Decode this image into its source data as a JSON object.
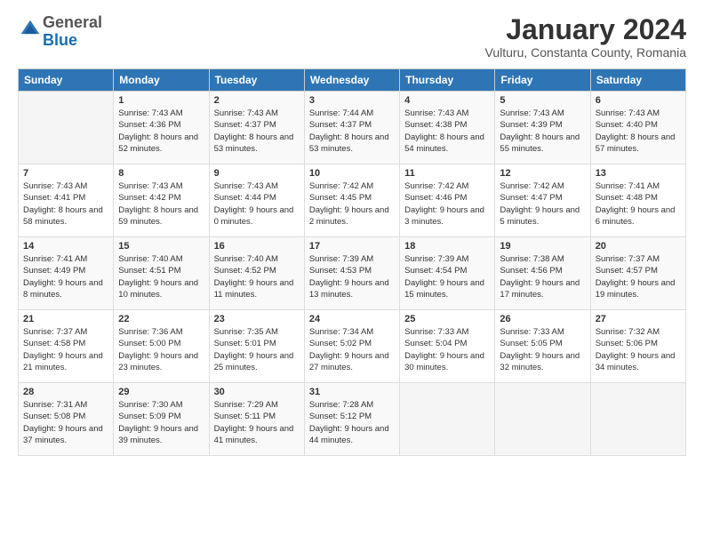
{
  "header": {
    "logo_general": "General",
    "logo_blue": "Blue",
    "month_title": "January 2024",
    "location": "Vulturu, Constanta County, Romania"
  },
  "weekdays": [
    "Sunday",
    "Monday",
    "Tuesday",
    "Wednesday",
    "Thursday",
    "Friday",
    "Saturday"
  ],
  "weeks": [
    [
      {
        "day": "",
        "sunrise": "",
        "sunset": "",
        "daylight": ""
      },
      {
        "day": "1",
        "sunrise": "Sunrise: 7:43 AM",
        "sunset": "Sunset: 4:36 PM",
        "daylight": "Daylight: 8 hours and 52 minutes."
      },
      {
        "day": "2",
        "sunrise": "Sunrise: 7:43 AM",
        "sunset": "Sunset: 4:37 PM",
        "daylight": "Daylight: 8 hours and 53 minutes."
      },
      {
        "day": "3",
        "sunrise": "Sunrise: 7:44 AM",
        "sunset": "Sunset: 4:37 PM",
        "daylight": "Daylight: 8 hours and 53 minutes."
      },
      {
        "day": "4",
        "sunrise": "Sunrise: 7:43 AM",
        "sunset": "Sunset: 4:38 PM",
        "daylight": "Daylight: 8 hours and 54 minutes."
      },
      {
        "day": "5",
        "sunrise": "Sunrise: 7:43 AM",
        "sunset": "Sunset: 4:39 PM",
        "daylight": "Daylight: 8 hours and 55 minutes."
      },
      {
        "day": "6",
        "sunrise": "Sunrise: 7:43 AM",
        "sunset": "Sunset: 4:40 PM",
        "daylight": "Daylight: 8 hours and 57 minutes."
      }
    ],
    [
      {
        "day": "7",
        "sunrise": "Sunrise: 7:43 AM",
        "sunset": "Sunset: 4:41 PM",
        "daylight": "Daylight: 8 hours and 58 minutes."
      },
      {
        "day": "8",
        "sunrise": "Sunrise: 7:43 AM",
        "sunset": "Sunset: 4:42 PM",
        "daylight": "Daylight: 8 hours and 59 minutes."
      },
      {
        "day": "9",
        "sunrise": "Sunrise: 7:43 AM",
        "sunset": "Sunset: 4:44 PM",
        "daylight": "Daylight: 9 hours and 0 minutes."
      },
      {
        "day": "10",
        "sunrise": "Sunrise: 7:42 AM",
        "sunset": "Sunset: 4:45 PM",
        "daylight": "Daylight: 9 hours and 2 minutes."
      },
      {
        "day": "11",
        "sunrise": "Sunrise: 7:42 AM",
        "sunset": "Sunset: 4:46 PM",
        "daylight": "Daylight: 9 hours and 3 minutes."
      },
      {
        "day": "12",
        "sunrise": "Sunrise: 7:42 AM",
        "sunset": "Sunset: 4:47 PM",
        "daylight": "Daylight: 9 hours and 5 minutes."
      },
      {
        "day": "13",
        "sunrise": "Sunrise: 7:41 AM",
        "sunset": "Sunset: 4:48 PM",
        "daylight": "Daylight: 9 hours and 6 minutes."
      }
    ],
    [
      {
        "day": "14",
        "sunrise": "Sunrise: 7:41 AM",
        "sunset": "Sunset: 4:49 PM",
        "daylight": "Daylight: 9 hours and 8 minutes."
      },
      {
        "day": "15",
        "sunrise": "Sunrise: 7:40 AM",
        "sunset": "Sunset: 4:51 PM",
        "daylight": "Daylight: 9 hours and 10 minutes."
      },
      {
        "day": "16",
        "sunrise": "Sunrise: 7:40 AM",
        "sunset": "Sunset: 4:52 PM",
        "daylight": "Daylight: 9 hours and 11 minutes."
      },
      {
        "day": "17",
        "sunrise": "Sunrise: 7:39 AM",
        "sunset": "Sunset: 4:53 PM",
        "daylight": "Daylight: 9 hours and 13 minutes."
      },
      {
        "day": "18",
        "sunrise": "Sunrise: 7:39 AM",
        "sunset": "Sunset: 4:54 PM",
        "daylight": "Daylight: 9 hours and 15 minutes."
      },
      {
        "day": "19",
        "sunrise": "Sunrise: 7:38 AM",
        "sunset": "Sunset: 4:56 PM",
        "daylight": "Daylight: 9 hours and 17 minutes."
      },
      {
        "day": "20",
        "sunrise": "Sunrise: 7:37 AM",
        "sunset": "Sunset: 4:57 PM",
        "daylight": "Daylight: 9 hours and 19 minutes."
      }
    ],
    [
      {
        "day": "21",
        "sunrise": "Sunrise: 7:37 AM",
        "sunset": "Sunset: 4:58 PM",
        "daylight": "Daylight: 9 hours and 21 minutes."
      },
      {
        "day": "22",
        "sunrise": "Sunrise: 7:36 AM",
        "sunset": "Sunset: 5:00 PM",
        "daylight": "Daylight: 9 hours and 23 minutes."
      },
      {
        "day": "23",
        "sunrise": "Sunrise: 7:35 AM",
        "sunset": "Sunset: 5:01 PM",
        "daylight": "Daylight: 9 hours and 25 minutes."
      },
      {
        "day": "24",
        "sunrise": "Sunrise: 7:34 AM",
        "sunset": "Sunset: 5:02 PM",
        "daylight": "Daylight: 9 hours and 27 minutes."
      },
      {
        "day": "25",
        "sunrise": "Sunrise: 7:33 AM",
        "sunset": "Sunset: 5:04 PM",
        "daylight": "Daylight: 9 hours and 30 minutes."
      },
      {
        "day": "26",
        "sunrise": "Sunrise: 7:33 AM",
        "sunset": "Sunset: 5:05 PM",
        "daylight": "Daylight: 9 hours and 32 minutes."
      },
      {
        "day": "27",
        "sunrise": "Sunrise: 7:32 AM",
        "sunset": "Sunset: 5:06 PM",
        "daylight": "Daylight: 9 hours and 34 minutes."
      }
    ],
    [
      {
        "day": "28",
        "sunrise": "Sunrise: 7:31 AM",
        "sunset": "Sunset: 5:08 PM",
        "daylight": "Daylight: 9 hours and 37 minutes."
      },
      {
        "day": "29",
        "sunrise": "Sunrise: 7:30 AM",
        "sunset": "Sunset: 5:09 PM",
        "daylight": "Daylight: 9 hours and 39 minutes."
      },
      {
        "day": "30",
        "sunrise": "Sunrise: 7:29 AM",
        "sunset": "Sunset: 5:11 PM",
        "daylight": "Daylight: 9 hours and 41 minutes."
      },
      {
        "day": "31",
        "sunrise": "Sunrise: 7:28 AM",
        "sunset": "Sunset: 5:12 PM",
        "daylight": "Daylight: 9 hours and 44 minutes."
      },
      {
        "day": "",
        "sunrise": "",
        "sunset": "",
        "daylight": ""
      },
      {
        "day": "",
        "sunrise": "",
        "sunset": "",
        "daylight": ""
      },
      {
        "day": "",
        "sunrise": "",
        "sunset": "",
        "daylight": ""
      }
    ]
  ]
}
